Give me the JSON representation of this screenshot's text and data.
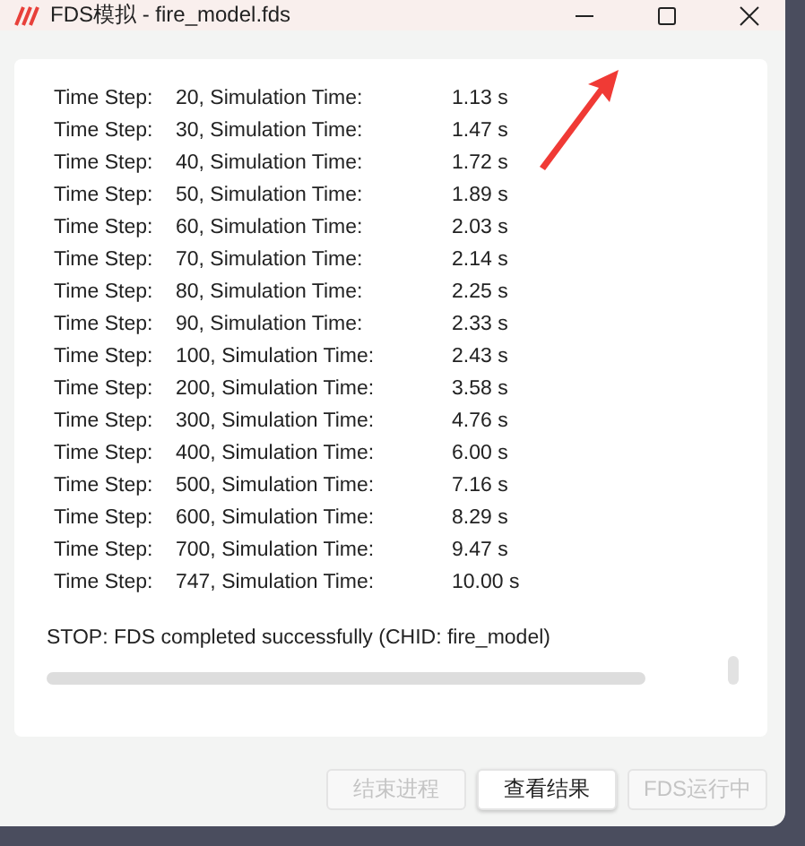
{
  "window": {
    "title": "FDS模拟 - fire_model.fds"
  },
  "log": {
    "rows": [
      {
        "label": "Time Step:",
        "step": "20, Simulation Time:",
        "time": "1.13 s"
      },
      {
        "label": "Time Step:",
        "step": "30, Simulation Time:",
        "time": "1.47 s"
      },
      {
        "label": "Time Step:",
        "step": "40, Simulation Time:",
        "time": "1.72 s"
      },
      {
        "label": "Time Step:",
        "step": "50, Simulation Time:",
        "time": "1.89 s"
      },
      {
        "label": "Time Step:",
        "step": "60, Simulation Time:",
        "time": "2.03 s"
      },
      {
        "label": "Time Step:",
        "step": "70, Simulation Time:",
        "time": "2.14 s"
      },
      {
        "label": "Time Step:",
        "step": "80, Simulation Time:",
        "time": "2.25 s"
      },
      {
        "label": "Time Step:",
        "step": "90, Simulation Time:",
        "time": "2.33 s"
      },
      {
        "label": "Time Step:",
        "step": "100, Simulation Time:",
        "time": "2.43 s"
      },
      {
        "label": "Time Step:",
        "step": "200, Simulation Time:",
        "time": "3.58 s"
      },
      {
        "label": "Time Step:",
        "step": "300, Simulation Time:",
        "time": "4.76 s"
      },
      {
        "label": "Time Step:",
        "step": "400, Simulation Time:",
        "time": "6.00 s"
      },
      {
        "label": "Time Step:",
        "step": "500, Simulation Time:",
        "time": "7.16 s"
      },
      {
        "label": "Time Step:",
        "step": "600, Simulation Time:",
        "time": "8.29 s"
      },
      {
        "label": "Time Step:",
        "step": "700, Simulation Time:",
        "time": "9.47 s"
      },
      {
        "label": "Time Step:",
        "step": "747, Simulation Time:",
        "time": "10.00 s"
      }
    ],
    "status": "STOP: FDS completed successfully (CHID: fire_model)"
  },
  "buttons": [
    {
      "label": "结束进程",
      "disabled": true
    },
    {
      "label": "查看结果",
      "disabled": false
    },
    {
      "label": "FDS运行中",
      "disabled": true
    }
  ]
}
